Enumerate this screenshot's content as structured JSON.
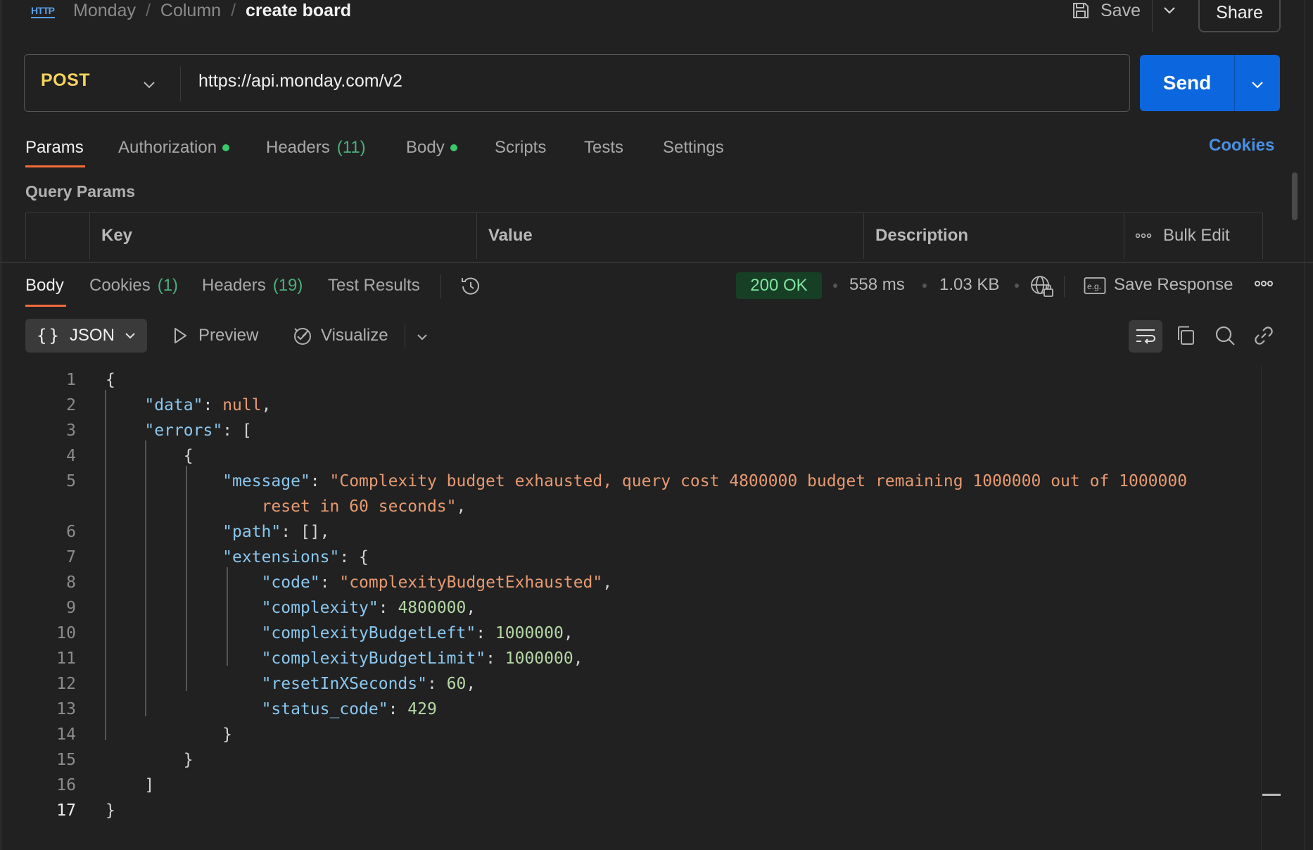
{
  "header": {
    "breadcrumb": [
      "Monday",
      "Column",
      "create board"
    ],
    "save_label": "Save",
    "share_label": "Share"
  },
  "request": {
    "method": "POST",
    "url": "https://api.monday.com/v2",
    "send_label": "Send"
  },
  "request_tabs": [
    {
      "label": "Params",
      "active": true
    },
    {
      "label": "Authorization",
      "dot": true
    },
    {
      "label": "Headers",
      "count": "(11)"
    },
    {
      "label": "Body",
      "dot": true
    },
    {
      "label": "Scripts"
    },
    {
      "label": "Tests"
    },
    {
      "label": "Settings"
    }
  ],
  "cookies_link": "Cookies",
  "query_params": {
    "title": "Query Params",
    "columns": [
      "Key",
      "Value",
      "Description"
    ],
    "bulk_edit": "Bulk Edit"
  },
  "response_tabs": [
    {
      "label": "Body",
      "active": true
    },
    {
      "label": "Cookies",
      "count": "(1)"
    },
    {
      "label": "Headers",
      "count": "(19)"
    },
    {
      "label": "Test Results"
    }
  ],
  "response_meta": {
    "status": "200 OK",
    "time": "558 ms",
    "size": "1.03 KB",
    "save_response": "Save Response"
  },
  "format_toolbar": {
    "format": "JSON",
    "preview": "Preview",
    "visualize": "Visualize"
  },
  "code_lines": [
    "1",
    "2",
    "3",
    "4",
    "5",
    "6",
    "7",
    "8",
    "9",
    "10",
    "11",
    "12",
    "13",
    "14",
    "15",
    "16",
    "17"
  ],
  "code": {
    "k_data": "\"data\"",
    "v_null": "null",
    "k_errors": "\"errors\"",
    "k_message": "\"message\"",
    "v_message_1": "\"Complexity budget exhausted, query cost 4800000 budget remaining 1000000 out of 1000000",
    "v_message_2": "reset in 60 seconds\"",
    "k_path": "\"path\"",
    "k_extensions": "\"extensions\"",
    "k_code": "\"code\"",
    "v_code": "\"complexityBudgetExhausted\"",
    "k_complexity": "\"complexity\"",
    "v_complexity": "4800000",
    "k_left": "\"complexityBudgetLeft\"",
    "v_left": "1000000",
    "k_limit": "\"complexityBudgetLimit\"",
    "v_limit": "1000000",
    "k_reset": "\"resetInXSeconds\"",
    "v_reset": "60",
    "k_status": "\"status_code\"",
    "v_status": "429"
  },
  "colors": {
    "method": "#f4d35e",
    "send": "#0c66de",
    "tab_underline": "#f26b3a",
    "status_ok_bg": "#173f26",
    "status_ok_text": "#7fe39f",
    "json_key": "#8bc7ee",
    "json_string": "#e69a72",
    "json_number": "#b6d7a6"
  }
}
